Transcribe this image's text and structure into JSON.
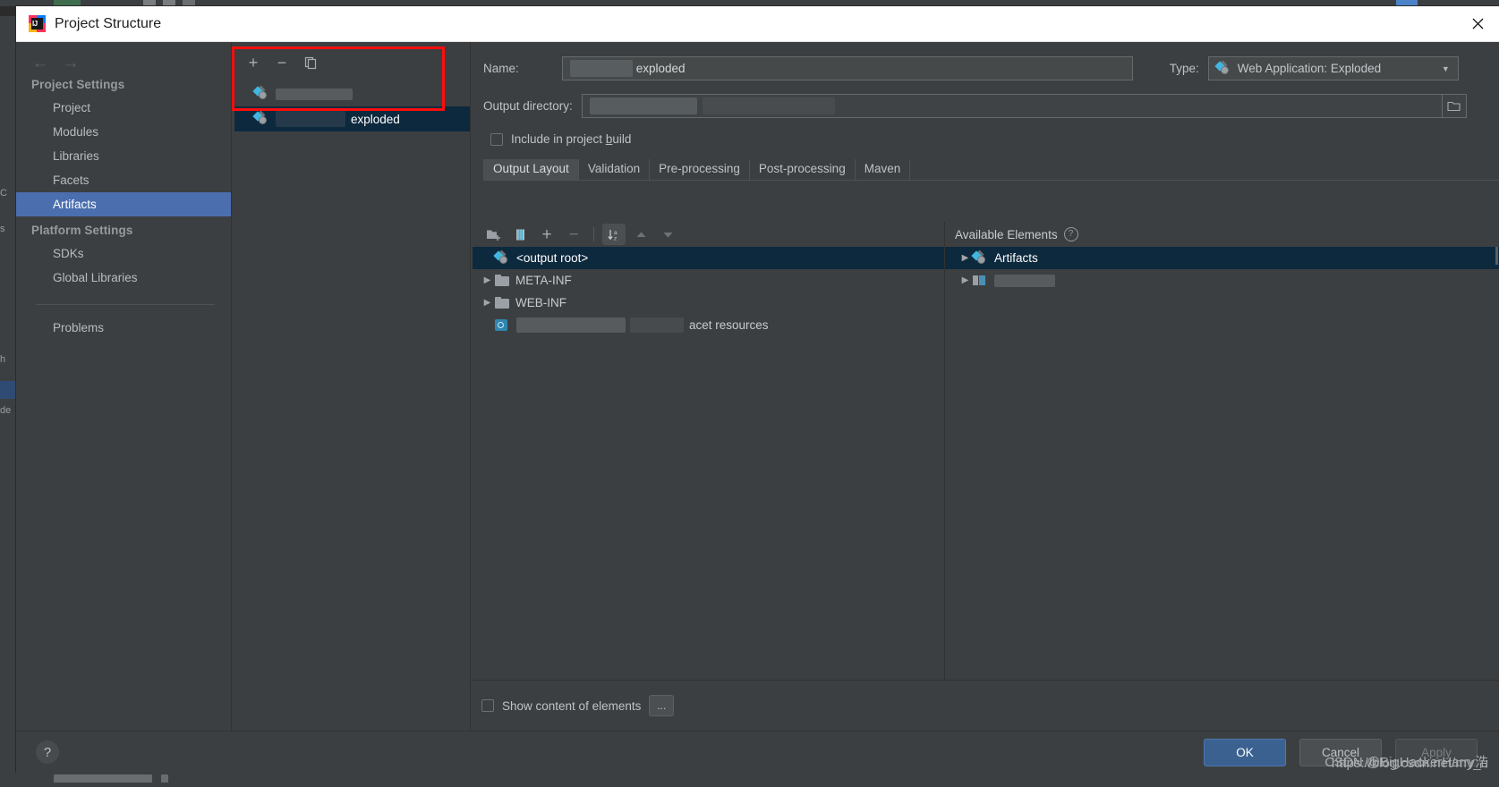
{
  "window": {
    "title": "Project Structure",
    "logo_icon": "intellij-idea-logo",
    "close_icon": "close-icon"
  },
  "nav": {
    "back_icon": "arrow-left-icon",
    "forward_icon": "arrow-right-icon"
  },
  "sidebar": {
    "sections": [
      {
        "header": "Project Settings",
        "items": [
          {
            "label": "Project",
            "selected": false
          },
          {
            "label": "Modules",
            "selected": false
          },
          {
            "label": "Libraries",
            "selected": false
          },
          {
            "label": "Facets",
            "selected": false
          },
          {
            "label": "Artifacts",
            "selected": true
          }
        ]
      },
      {
        "header": "Platform Settings",
        "items": [
          {
            "label": "SDKs",
            "selected": false
          },
          {
            "label": "Global Libraries",
            "selected": false
          }
        ]
      }
    ],
    "extra_item": "Problems"
  },
  "artifacts_panel": {
    "toolbar": {
      "add_icon": "plus-icon",
      "remove_icon": "minus-icon",
      "copy_icon": "copy-icon"
    },
    "items": [
      {
        "label": "",
        "redacted": true,
        "selected": false,
        "icon": "artifact-icon"
      },
      {
        "label": "exploded",
        "redacted": true,
        "selected": true,
        "icon": "artifact-icon"
      }
    ],
    "highlight_color": "#fd0d0d"
  },
  "detail": {
    "name_label": "Name:",
    "name_value": "exploded",
    "type_label": "Type:",
    "type_value": "Web Application: Exploded",
    "type_icon": "artifact-icon",
    "type_chevron_icon": "chevron-down-icon",
    "output_directory_label": "Output directory:",
    "output_directory_value": "",
    "browse_icon": "folder-browse-icon",
    "include_in_build_label_pre": "Include in project ",
    "include_in_build_label_mnemonic": "b",
    "include_in_build_label_post": "uild",
    "include_in_build_checked": false,
    "tabs": [
      {
        "label": "Output Layout",
        "active": true
      },
      {
        "label": "Validation",
        "active": false
      },
      {
        "label": "Pre-processing",
        "active": false
      },
      {
        "label": "Post-processing",
        "active": false
      },
      {
        "label": "Maven",
        "active": false
      }
    ]
  },
  "output_layout": {
    "toolbar": [
      {
        "icon": "add-directory-icon"
      },
      {
        "icon": "add-archive-icon"
      },
      {
        "icon": "add-copy-icon"
      },
      {
        "icon": "minus-icon"
      },
      {
        "icon": "sort-alphabetically-icon",
        "active": true
      },
      {
        "icon": "move-up-icon"
      },
      {
        "icon": "move-down-icon"
      }
    ],
    "tree": [
      {
        "label": "<output root>",
        "icon": "artifact-icon",
        "indent": 0,
        "selected": true,
        "twisty": ""
      },
      {
        "label": "META-INF",
        "icon": "folder-icon",
        "indent": 1,
        "selected": false,
        "twisty": "collapsed"
      },
      {
        "label": "WEB-INF",
        "icon": "folder-icon",
        "indent": 1,
        "selected": false,
        "twisty": "collapsed"
      },
      {
        "label": "acet resources",
        "icon": "facet-icon",
        "indent": 1,
        "selected": false,
        "twisty": "",
        "redacted": true
      }
    ]
  },
  "available_elements": {
    "header": "Available Elements",
    "help_icon": "help-circle-icon",
    "tree": [
      {
        "label": "Artifacts",
        "icon": "artifact-icon",
        "selected": true,
        "twisty": "collapsed"
      },
      {
        "label": "",
        "icon": "module-icon",
        "selected": false,
        "twisty": "collapsed",
        "redacted": true
      }
    ]
  },
  "bottom_controls": {
    "show_content_label": "Show content of elements",
    "show_content_checked": false,
    "ellipsis_label": "..."
  },
  "footer": {
    "help_icon": "help-icon",
    "help_glyph": "?",
    "buttons": [
      {
        "label": "OK",
        "style": "primary"
      },
      {
        "label": "Cancel",
        "style": "normal"
      },
      {
        "label": "Apply",
        "style": "disabled"
      }
    ]
  },
  "watermark": {
    "line_a": "CSDN @BigHackerHarry浩",
    "line_b": "https://blog.csdn.net/my_u"
  },
  "colors": {
    "window_bg": "#3c3f41",
    "titlebar_bg": "#ffffff",
    "selection_blue": "#4b6eaf",
    "tree_selection": "#0d293e",
    "accent_red": "#fd0d0d",
    "primary_button": "#3b6190"
  }
}
